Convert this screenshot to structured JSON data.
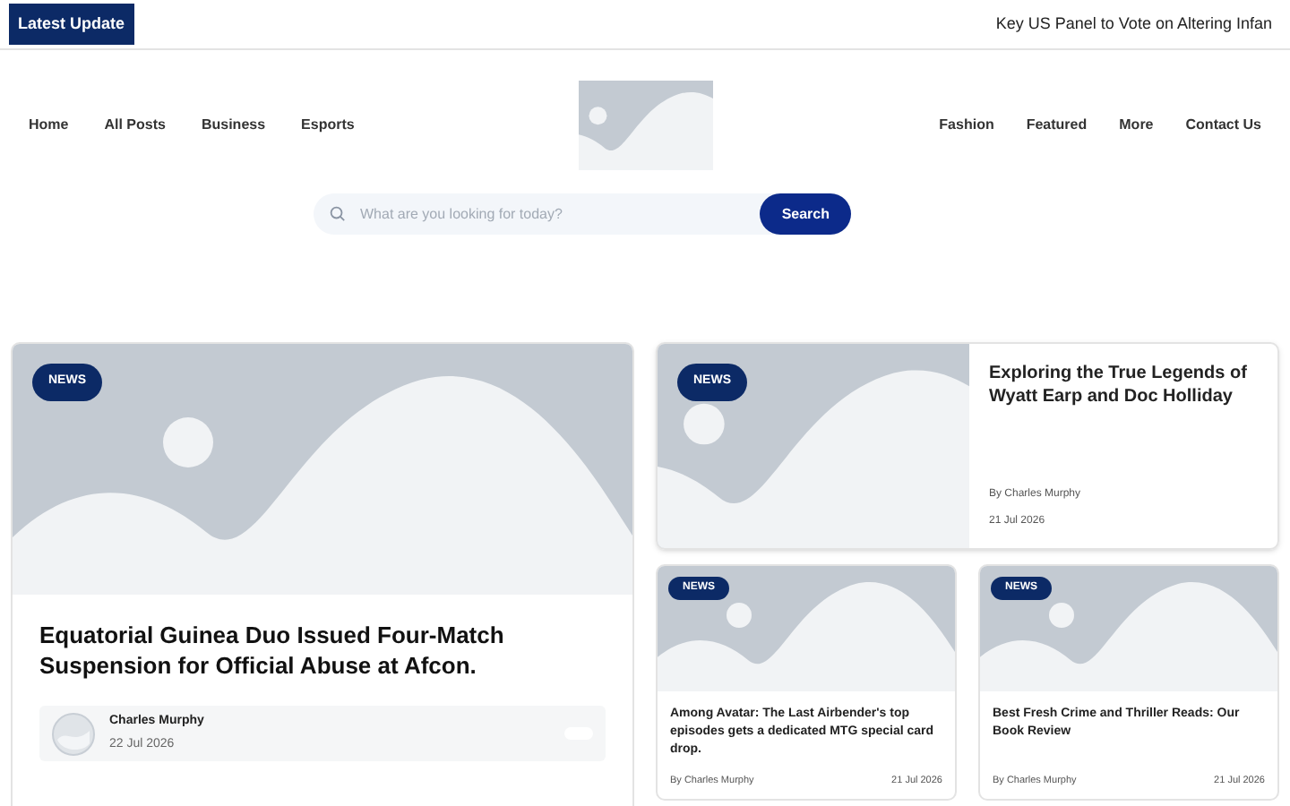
{
  "top_bar": {
    "badge": "Latest Update",
    "ticker": "Key US Panel to Vote on Altering Infan"
  },
  "nav_left": [
    "Home",
    "All Posts",
    "Business",
    "Esports"
  ],
  "nav_right": [
    "Fashion",
    "Featured",
    "More",
    "Contact Us"
  ],
  "search": {
    "placeholder": "What are you looking for today?",
    "button": "Search"
  },
  "featured": {
    "tag": "NEWS",
    "title": "Equatorial Guinea Duo Issued Four-Match Suspension for Official Abuse at Afcon.",
    "author": "Charles Murphy",
    "date": "22 Jul 2026"
  },
  "side_post": {
    "tag": "NEWS",
    "title": "Exploring the True Legends of Wyatt Earp and Doc Holliday",
    "byline": "By Charles Murphy",
    "date": "21 Jul 2026"
  },
  "grid_posts": [
    {
      "tag": "NEWS",
      "title": "Among Avatar: The Last Airbender's top episodes gets a dedicated MTG special card drop.",
      "byline": "By Charles Murphy",
      "date": "21 Jul 2026"
    },
    {
      "tag": "NEWS",
      "title": "Best Fresh Crime and Thriller Reads: Our Book Review",
      "byline": "By Charles Murphy",
      "date": "21 Jul 2026"
    }
  ]
}
